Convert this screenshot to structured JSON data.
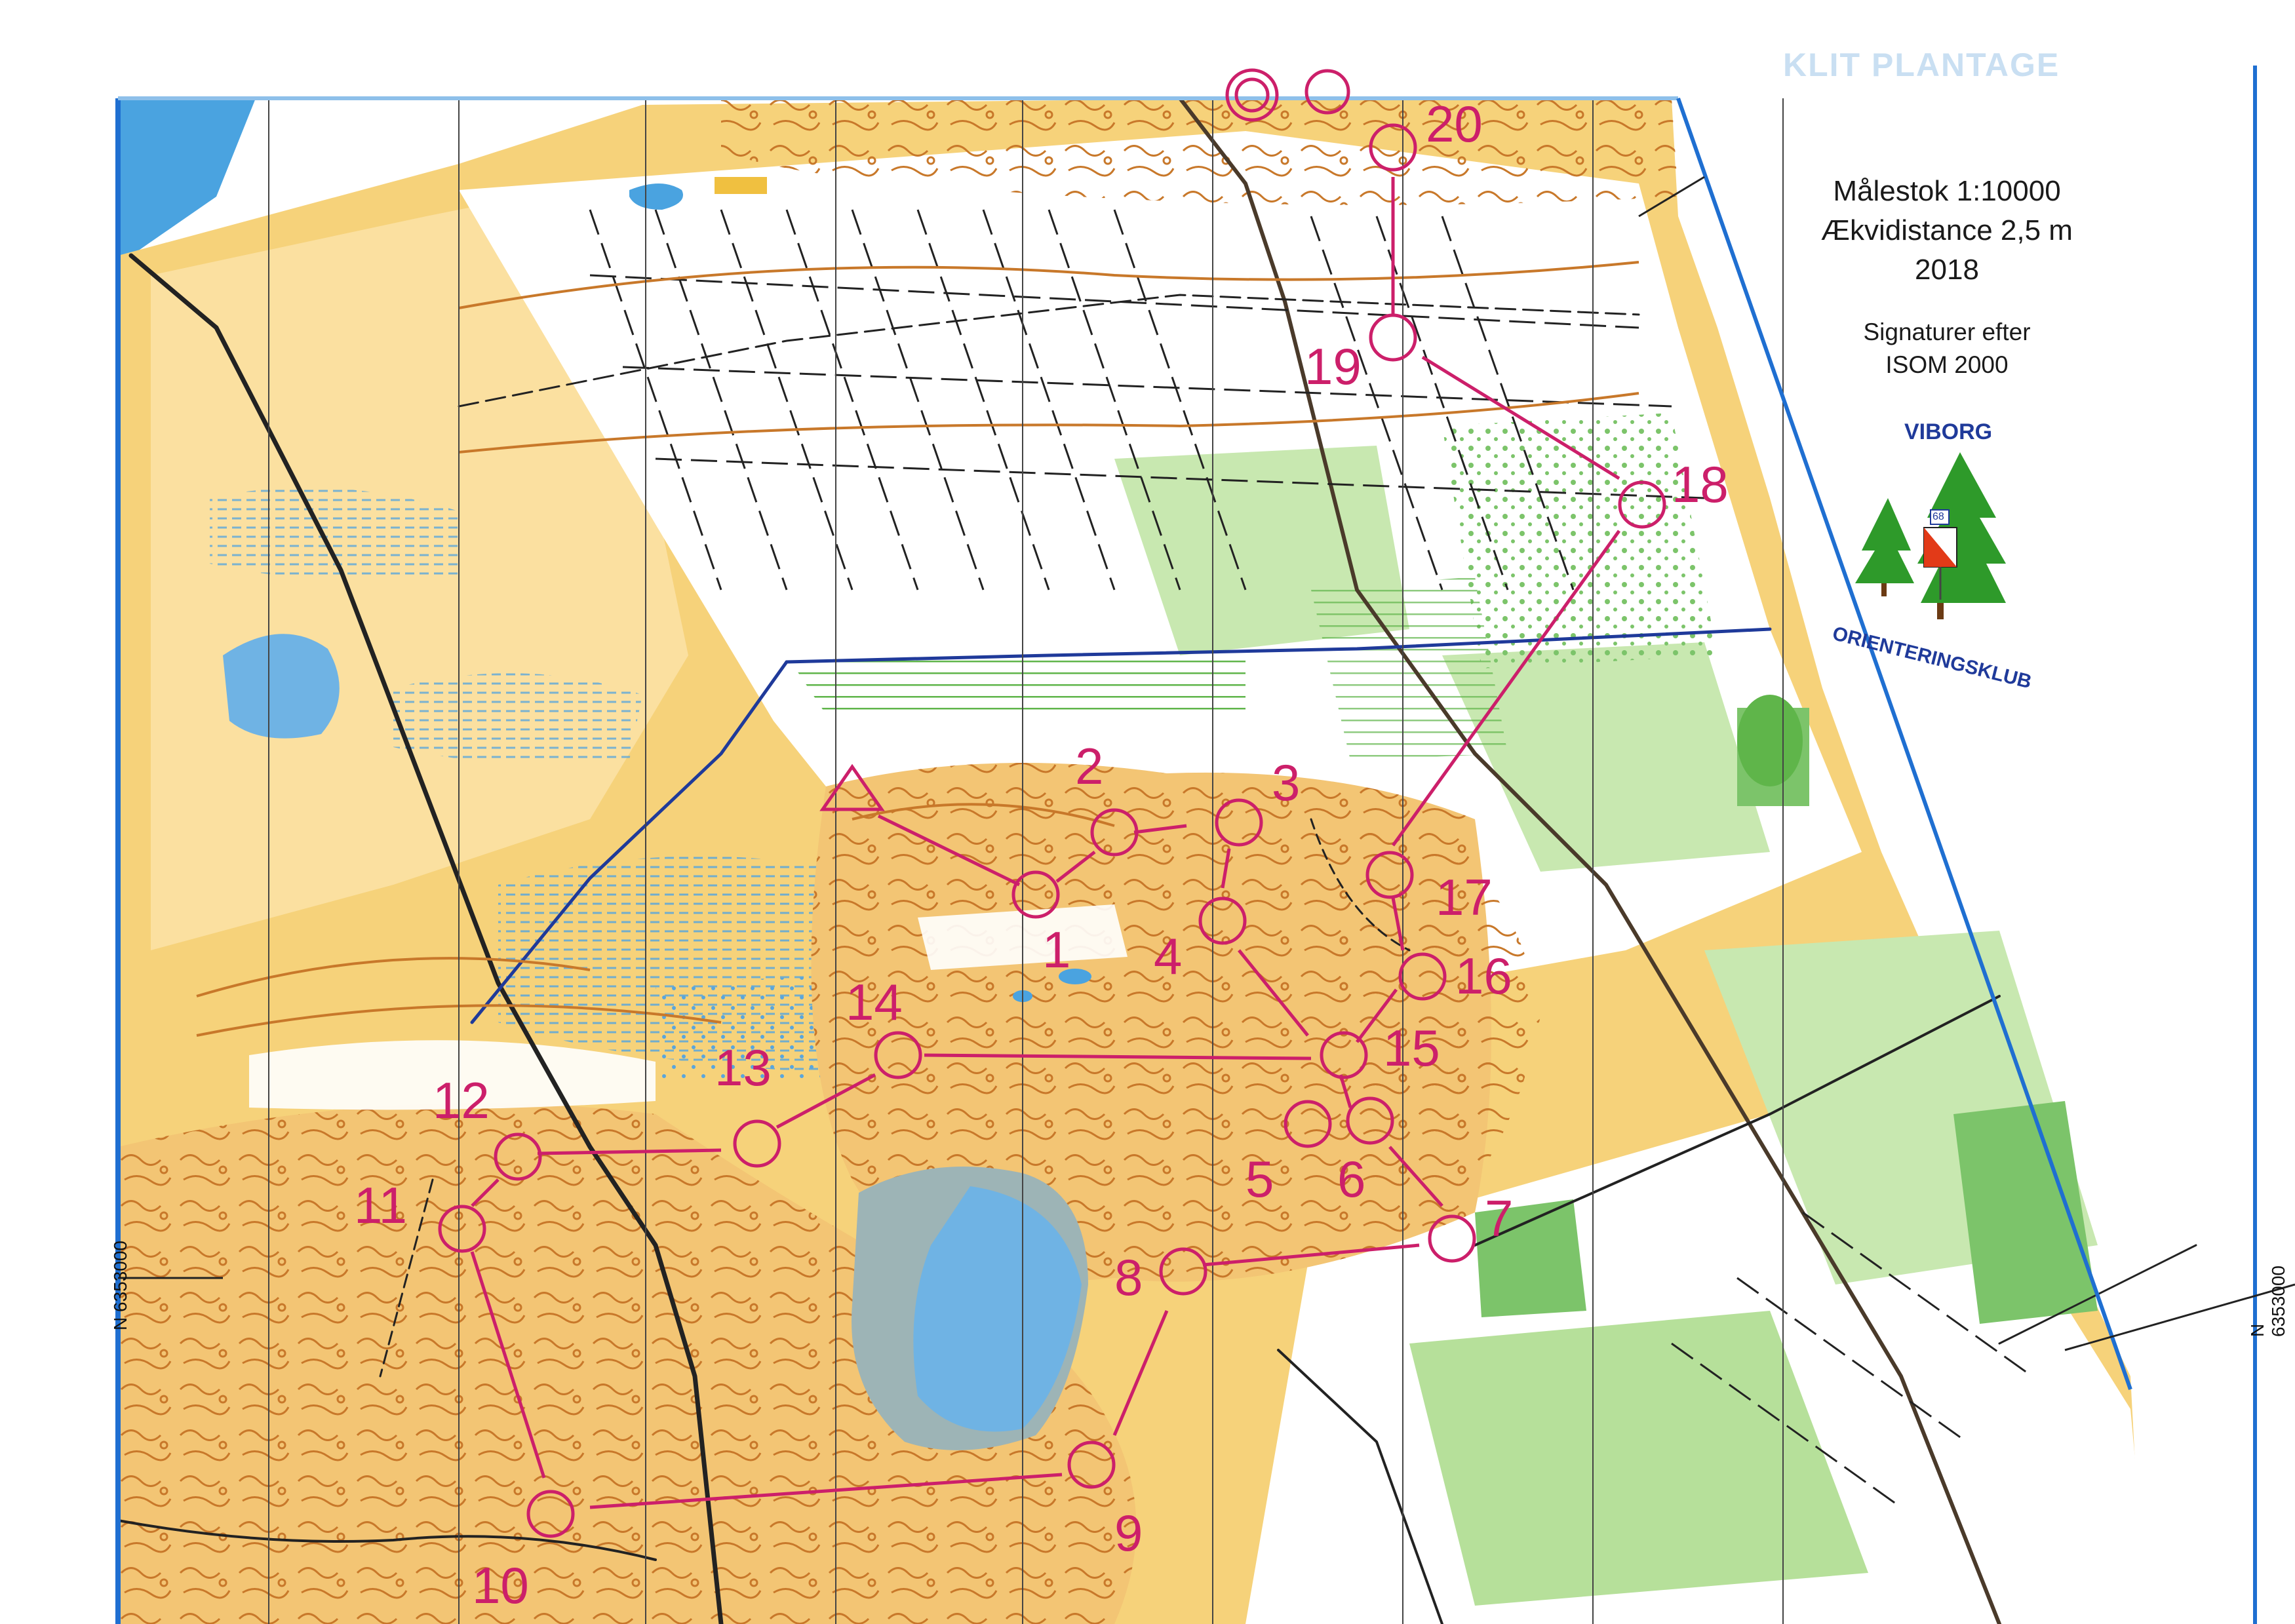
{
  "map": {
    "header_partial": "KLIT PLANTAGE",
    "scale": "Målestok 1:10000",
    "contour_interval": "Ækvidistance 2,5 m",
    "year": "2018",
    "symbols_line1": "Signaturer efter",
    "symbols_line2": "ISOM 2000",
    "grid_label_left": "N 6353000",
    "grid_label_right": "N 6353000",
    "club_logo": {
      "top_text": "VIBORG",
      "bottom_text": "ORIENTERINGSKLUB",
      "badge": "68",
      "icon": "trees-and-control-flag-logo"
    },
    "course": {
      "color": "#cc1f6a",
      "start_icon": "start-triangle-icon",
      "finish_icon": "finish-double-circle-icon",
      "controls": [
        {
          "number": "1"
        },
        {
          "number": "2"
        },
        {
          "number": "3"
        },
        {
          "number": "4"
        },
        {
          "number": "5"
        },
        {
          "number": "6"
        },
        {
          "number": "7"
        },
        {
          "number": "8"
        },
        {
          "number": "9"
        },
        {
          "number": "10"
        },
        {
          "number": "11"
        },
        {
          "number": "12"
        },
        {
          "number": "13"
        },
        {
          "number": "14"
        },
        {
          "number": "15"
        },
        {
          "number": "16"
        },
        {
          "number": "17"
        },
        {
          "number": "18"
        },
        {
          "number": "19"
        },
        {
          "number": "20"
        }
      ]
    },
    "colors": {
      "open_land": "#f6d27a",
      "rough_open": "#fbe9b8",
      "forest": "#ffffff",
      "green_light": "#c8e8b0",
      "green_dark": "#7cc46a",
      "water": "#6fb3e4",
      "marsh": "#5aa6dc",
      "contour": "#c8782a",
      "path": "#222222",
      "north_line": "#444444"
    }
  }
}
